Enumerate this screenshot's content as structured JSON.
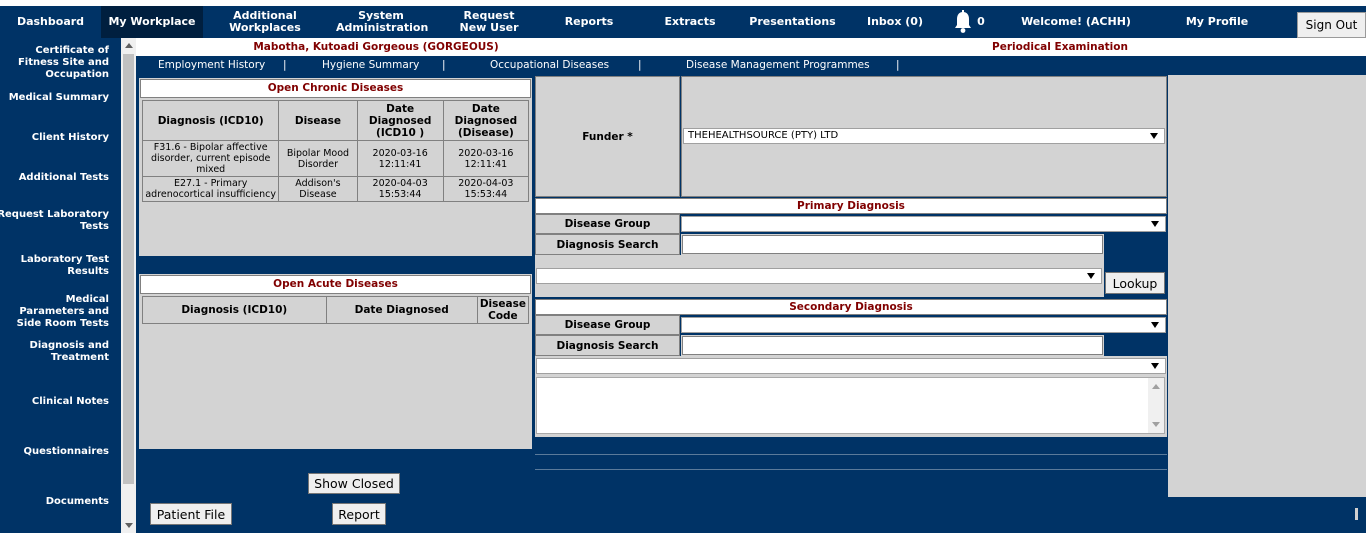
{
  "nav": {
    "items": [
      {
        "label": "Dashboard"
      },
      {
        "label": "My Workplace"
      },
      {
        "label": "Additional Workplaces"
      },
      {
        "label": "System Administration"
      },
      {
        "label": "Request New User"
      },
      {
        "label": "Reports"
      },
      {
        "label": "Extracts"
      },
      {
        "label": "Presentations"
      },
      {
        "label": "Inbox (0)"
      }
    ],
    "notification_count": "0",
    "welcome": "Welcome! (ACHH)",
    "profile": "My Profile",
    "sign_out": "Sign Out"
  },
  "sidebar": {
    "items": [
      {
        "label": "Certificate of Fitness Site and Occupation"
      },
      {
        "label": "Medical Summary"
      },
      {
        "label": "Client History"
      },
      {
        "label": "Additional Tests"
      },
      {
        "label": "Request Laboratory Tests"
      },
      {
        "label": "Laboratory Test Results"
      },
      {
        "label": "Medical Parameters and Side Room Tests"
      },
      {
        "label": "Diagnosis and Treatment"
      },
      {
        "label": "Clinical Notes"
      },
      {
        "label": "Questionnaires"
      },
      {
        "label": "Documents"
      }
    ]
  },
  "header": {
    "patient_name": "Mabotha, Kutoadi Gorgeous (GORGEOUS)",
    "exam_type": "Periodical Examination"
  },
  "subtabs": [
    {
      "label": "Employment History"
    },
    {
      "label": "Hygiene Summary"
    },
    {
      "label": "Occupational Diseases"
    },
    {
      "label": "Disease Management Programmes"
    }
  ],
  "chronic": {
    "title": "Open Chronic Diseases",
    "headers": [
      "Diagnosis (ICD10)",
      "Disease",
      "Date Diagnosed (ICD10 )",
      "Date Diagnosed (Disease)"
    ],
    "rows": [
      {
        "diagnosis": "F31.6 - Bipolar affective disorder, current episode mixed",
        "disease": "Bipolar Mood Disorder",
        "date_icd": "2020-03-16 12:11:41",
        "date_disease": "2020-03-16 12:11:41"
      },
      {
        "diagnosis": "E27.1 - Primary adrenocortical insufficiency",
        "disease": "Addison's Disease",
        "date_icd": "2020-04-03 15:53:44",
        "date_disease": "2020-04-03 15:53:44"
      }
    ]
  },
  "acute": {
    "title": "Open Acute Diseases",
    "headers": [
      "Diagnosis (ICD10)",
      "Date Diagnosed",
      "Disease Code"
    ]
  },
  "buttons": {
    "show_closed": "Show Closed",
    "patient_file": "Patient File",
    "report": "Report",
    "lookup": "Lookup"
  },
  "funder": {
    "label": "Funder *",
    "value": "THEHEALTHSOURCE (PTY) LTD"
  },
  "primary": {
    "title": "Primary Diagnosis",
    "disease_group_label": "Disease Group",
    "diagnosis_search_label": "Diagnosis Search"
  },
  "secondary": {
    "title": "Secondary Diagnosis",
    "disease_group_label": "Disease Group",
    "diagnosis_search_label": "Diagnosis Search"
  }
}
